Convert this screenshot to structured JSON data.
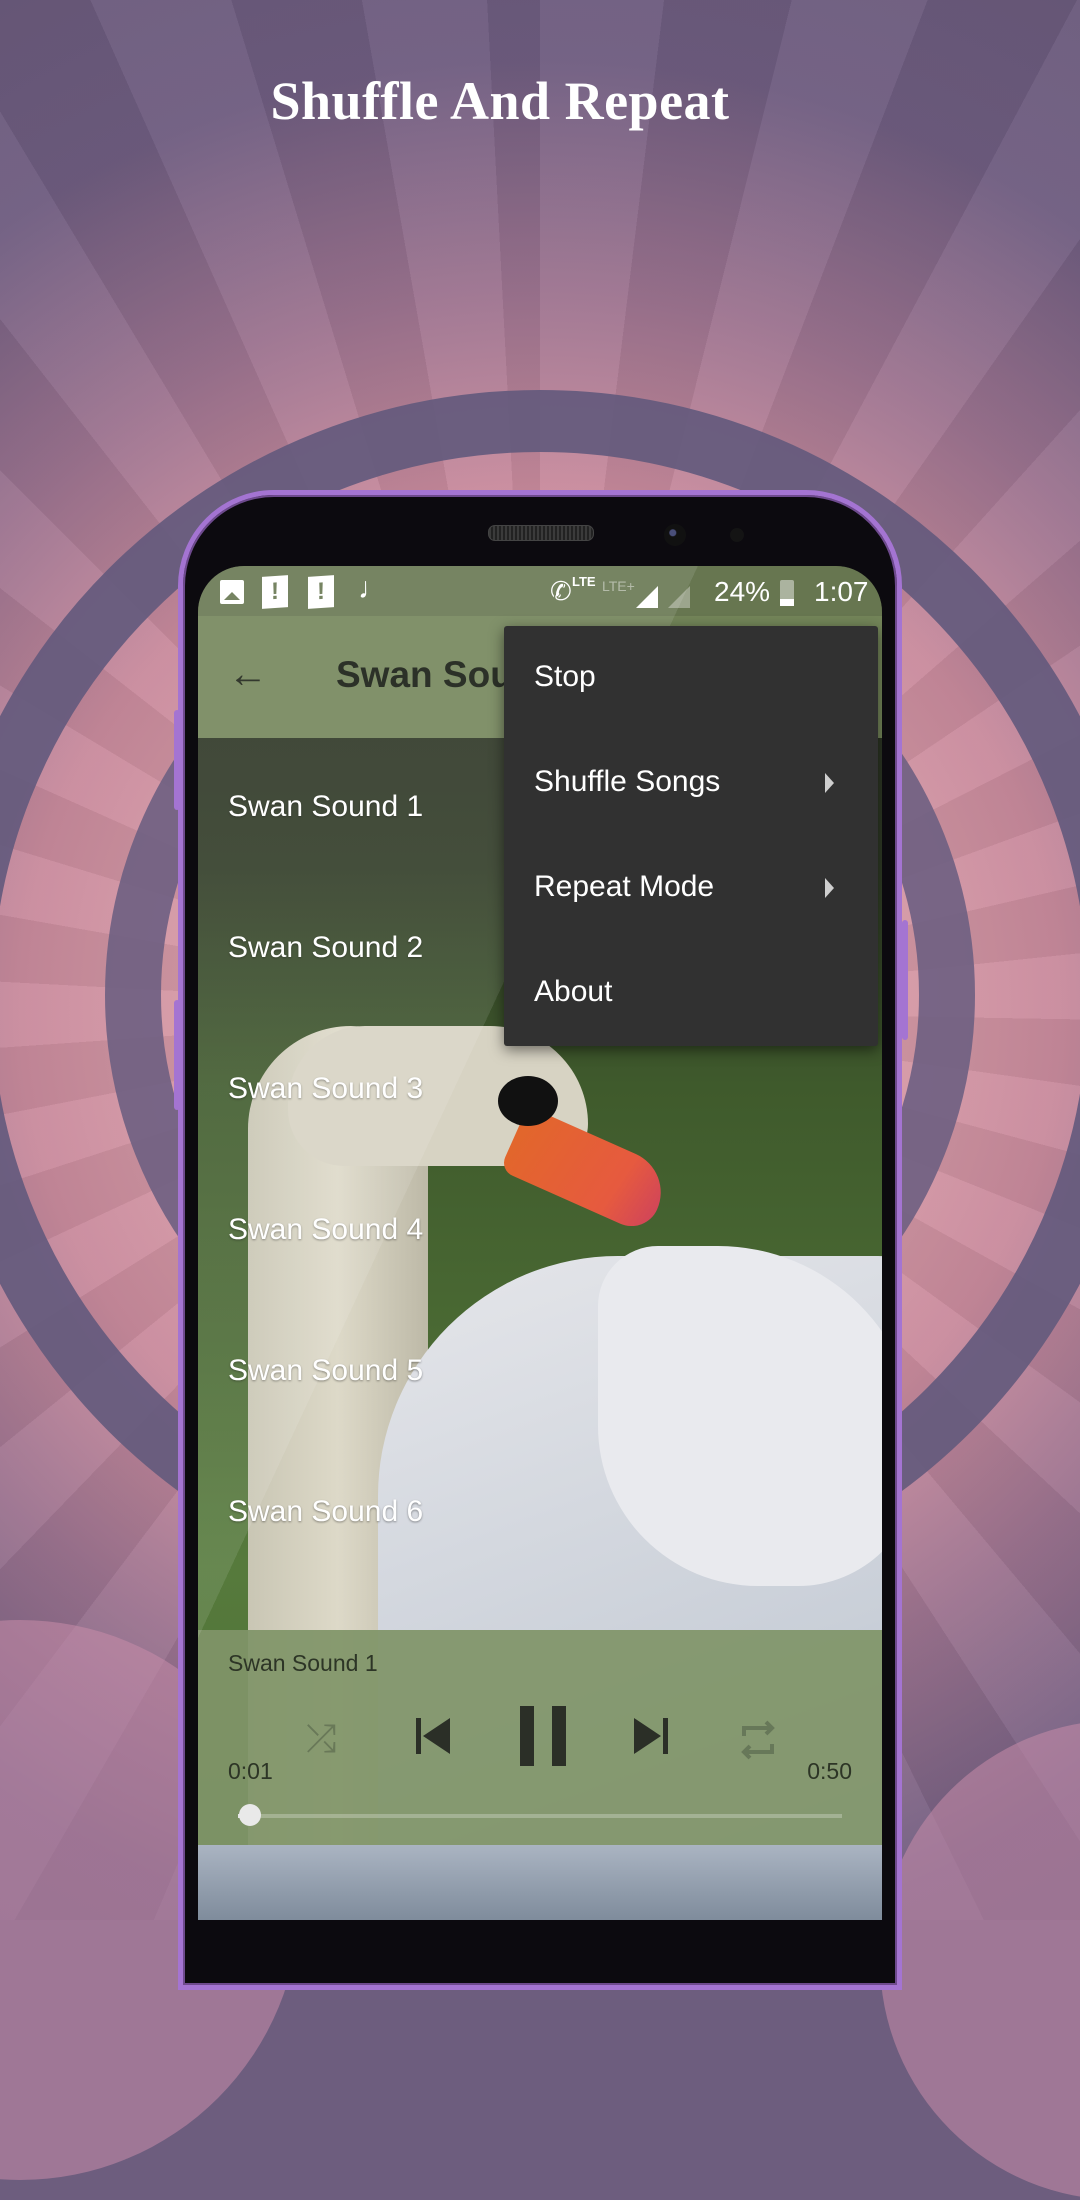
{
  "promo": {
    "title": "Shuffle And Repeat"
  },
  "status_bar": {
    "icons_left": [
      "image-icon",
      "alert-icon",
      "alert-icon",
      "music-note-icon"
    ],
    "lte_call_label": "LTE",
    "lte_plus_label": "LTE+",
    "battery_percent": "24%",
    "battery_level": 0.24,
    "time": "1:07"
  },
  "app_bar": {
    "back_icon": "arrow-left-icon",
    "title": "Swan Sounds"
  },
  "songs": [
    {
      "label": "Swan Sound 1"
    },
    {
      "label": "Swan Sound 2"
    },
    {
      "label": "Swan Sound 3"
    },
    {
      "label": "Swan Sound 4"
    },
    {
      "label": "Swan Sound 5"
    },
    {
      "label": "Swan Sound 6"
    }
  ],
  "menu": {
    "items": [
      {
        "label": "Stop",
        "has_submenu": false
      },
      {
        "label": "Shuffle Songs",
        "has_submenu": true
      },
      {
        "label": "Repeat Mode",
        "has_submenu": true
      },
      {
        "label": "About",
        "has_submenu": false
      }
    ]
  },
  "player": {
    "now_playing": "Swan Sound 1",
    "current_time": "0:01",
    "total_time": "0:50",
    "progress": 0.02,
    "shuffle_icon": "shuffle-icon",
    "prev_icon": "skip-previous-icon",
    "pause_icon": "pause-icon",
    "next_icon": "skip-next-icon",
    "repeat_icon": "repeat-icon",
    "shuffle_glyph": "⤮",
    "repeat_glyph": "🔁"
  },
  "colors": {
    "status_bar": "#677650",
    "app_bar": "#738559",
    "menu_bg": "#313131",
    "phone_frame": "#a474d2"
  }
}
